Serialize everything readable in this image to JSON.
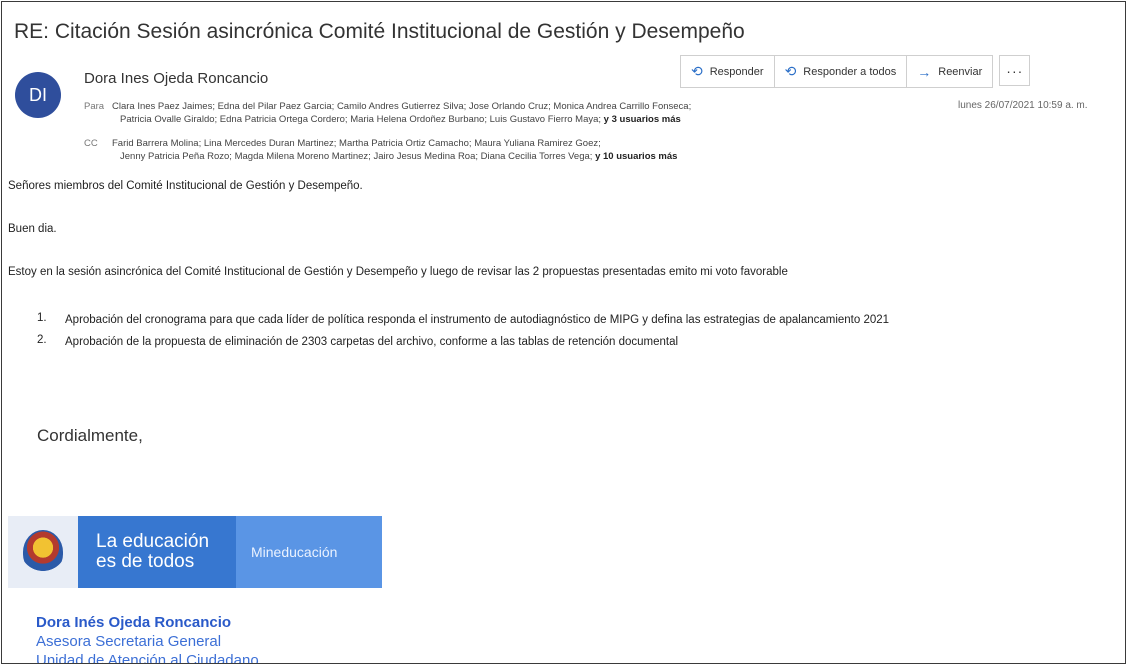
{
  "email": {
    "subject": "RE: Citación Sesión asincrónica Comité Institucional de Gestión y Desempeño",
    "avatar_initials": "DI",
    "sender": "Dora Ines Ojeda Roncancio",
    "date": "lunes 26/07/2021 10:59 a. m.",
    "to_label": "Para",
    "to_line1": "Clara Ines Paez Jaimes; Edna del Pilar Paez Garcia; Camilo Andres Gutierrez Silva; Jose Orlando Cruz; Monica Andrea Carrillo Fonseca;",
    "to_line2": "Patricia Ovalle Giraldo; Edna Patricia Ortega Cordero; Maria Helena Ordoñez Burbano; Luis Gustavo Fierro Maya;",
    "to_more": "y 3 usuarios más",
    "cc_label": "CC",
    "cc_line1": "Farid Barrera Molina; Lina Mercedes Duran Martinez; Martha Patricia Ortiz Camacho; Maura Yuliana Ramirez Goez;",
    "cc_line2": "Jenny Patricia Peña Rozo; Magda Milena Moreno Martinez; Jairo Jesus Medina Roa; Diana Cecilia Torres Vega;",
    "cc_more": "y 10 usuarios más"
  },
  "actions": {
    "reply": "Responder",
    "reply_all": "Responder a todos",
    "forward": "Reenviar",
    "more": "···"
  },
  "icons": {
    "reply": "reply-icon",
    "reply_all": "reply-all-icon",
    "forward": "forward-icon",
    "more": "more-icon"
  },
  "body": {
    "greeting": "Señores miembros del Comité Institucional de Gestión y Desempeño.",
    "hello": "Buen dia.",
    "paragraph": "Estoy  en la sesión asincrónica del Comité Institucional de Gestión y Desempeño y luego de  revisar las 2 propuestas presentadas  emito mi  voto  favorable",
    "items": [
      {
        "num": "1.",
        "text": "Aprobación del cronograma para que cada líder de política responda el instrumento de autodiagnóstico de MIPG y defina las estrategias de apalancamiento 2021"
      },
      {
        "num": "2.",
        "text": "Aprobación de la propuesta de eliminación de 2303 carpetas del archivo, conforme a las tablas de retención documental"
      }
    ],
    "closing": "Cordialmente,"
  },
  "banner": {
    "line1": "La educación",
    "line2": "es de todos",
    "brand": "Mineducación"
  },
  "signature": {
    "name": "Dora Inés Ojeda Roncancio",
    "role": "Asesora Secretaria General",
    "unit": "Unidad de Atención al Ciudadano"
  },
  "colors": {
    "avatar": "#2f4e9c",
    "banner_dark": "#3777d0",
    "banner_light": "#5a95e5",
    "signature": "#2a5ac9"
  }
}
